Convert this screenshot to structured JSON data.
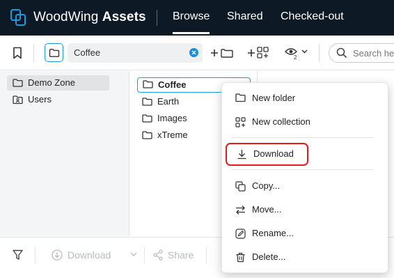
{
  "header": {
    "brand_regular": "WoodWing ",
    "brand_bold": "Assets",
    "tabs": [
      {
        "label": "Browse",
        "active": true
      },
      {
        "label": "Shared",
        "active": false
      },
      {
        "label": "Checked-out",
        "active": false
      }
    ]
  },
  "toolbar": {
    "path_value": "Coffee",
    "search_placeholder": "Search he",
    "views_badge": "2"
  },
  "left_tree": [
    {
      "label": "Demo Zone",
      "icon": "folder-icon",
      "selected": true
    },
    {
      "label": "Users",
      "icon": "users-folder-icon",
      "selected": false
    }
  ],
  "folders": [
    {
      "label": "Coffee",
      "selected": true
    },
    {
      "label": "Earth",
      "selected": false
    },
    {
      "label": "Images",
      "selected": false
    },
    {
      "label": "xTreme",
      "selected": false
    }
  ],
  "bottom_bar": {
    "download_label": "Download",
    "share_label": "Share"
  },
  "context_menu": {
    "items": [
      {
        "label": "New folder",
        "icon": "folder-icon"
      },
      {
        "label": "New collection",
        "icon": "collection-icon"
      },
      {
        "label": "Download",
        "icon": "download-icon",
        "highlighted": true
      },
      {
        "label": "Copy...",
        "icon": "copy-icon"
      },
      {
        "label": "Move...",
        "icon": "move-arrows-icon"
      },
      {
        "label": "Rename...",
        "icon": "rename-icon"
      },
      {
        "label": "Delete...",
        "icon": "trash-icon"
      }
    ]
  },
  "colors": {
    "header_bg": "#0d1a26",
    "accent": "#1a9be0",
    "highlight_border": "#e31b1b"
  }
}
